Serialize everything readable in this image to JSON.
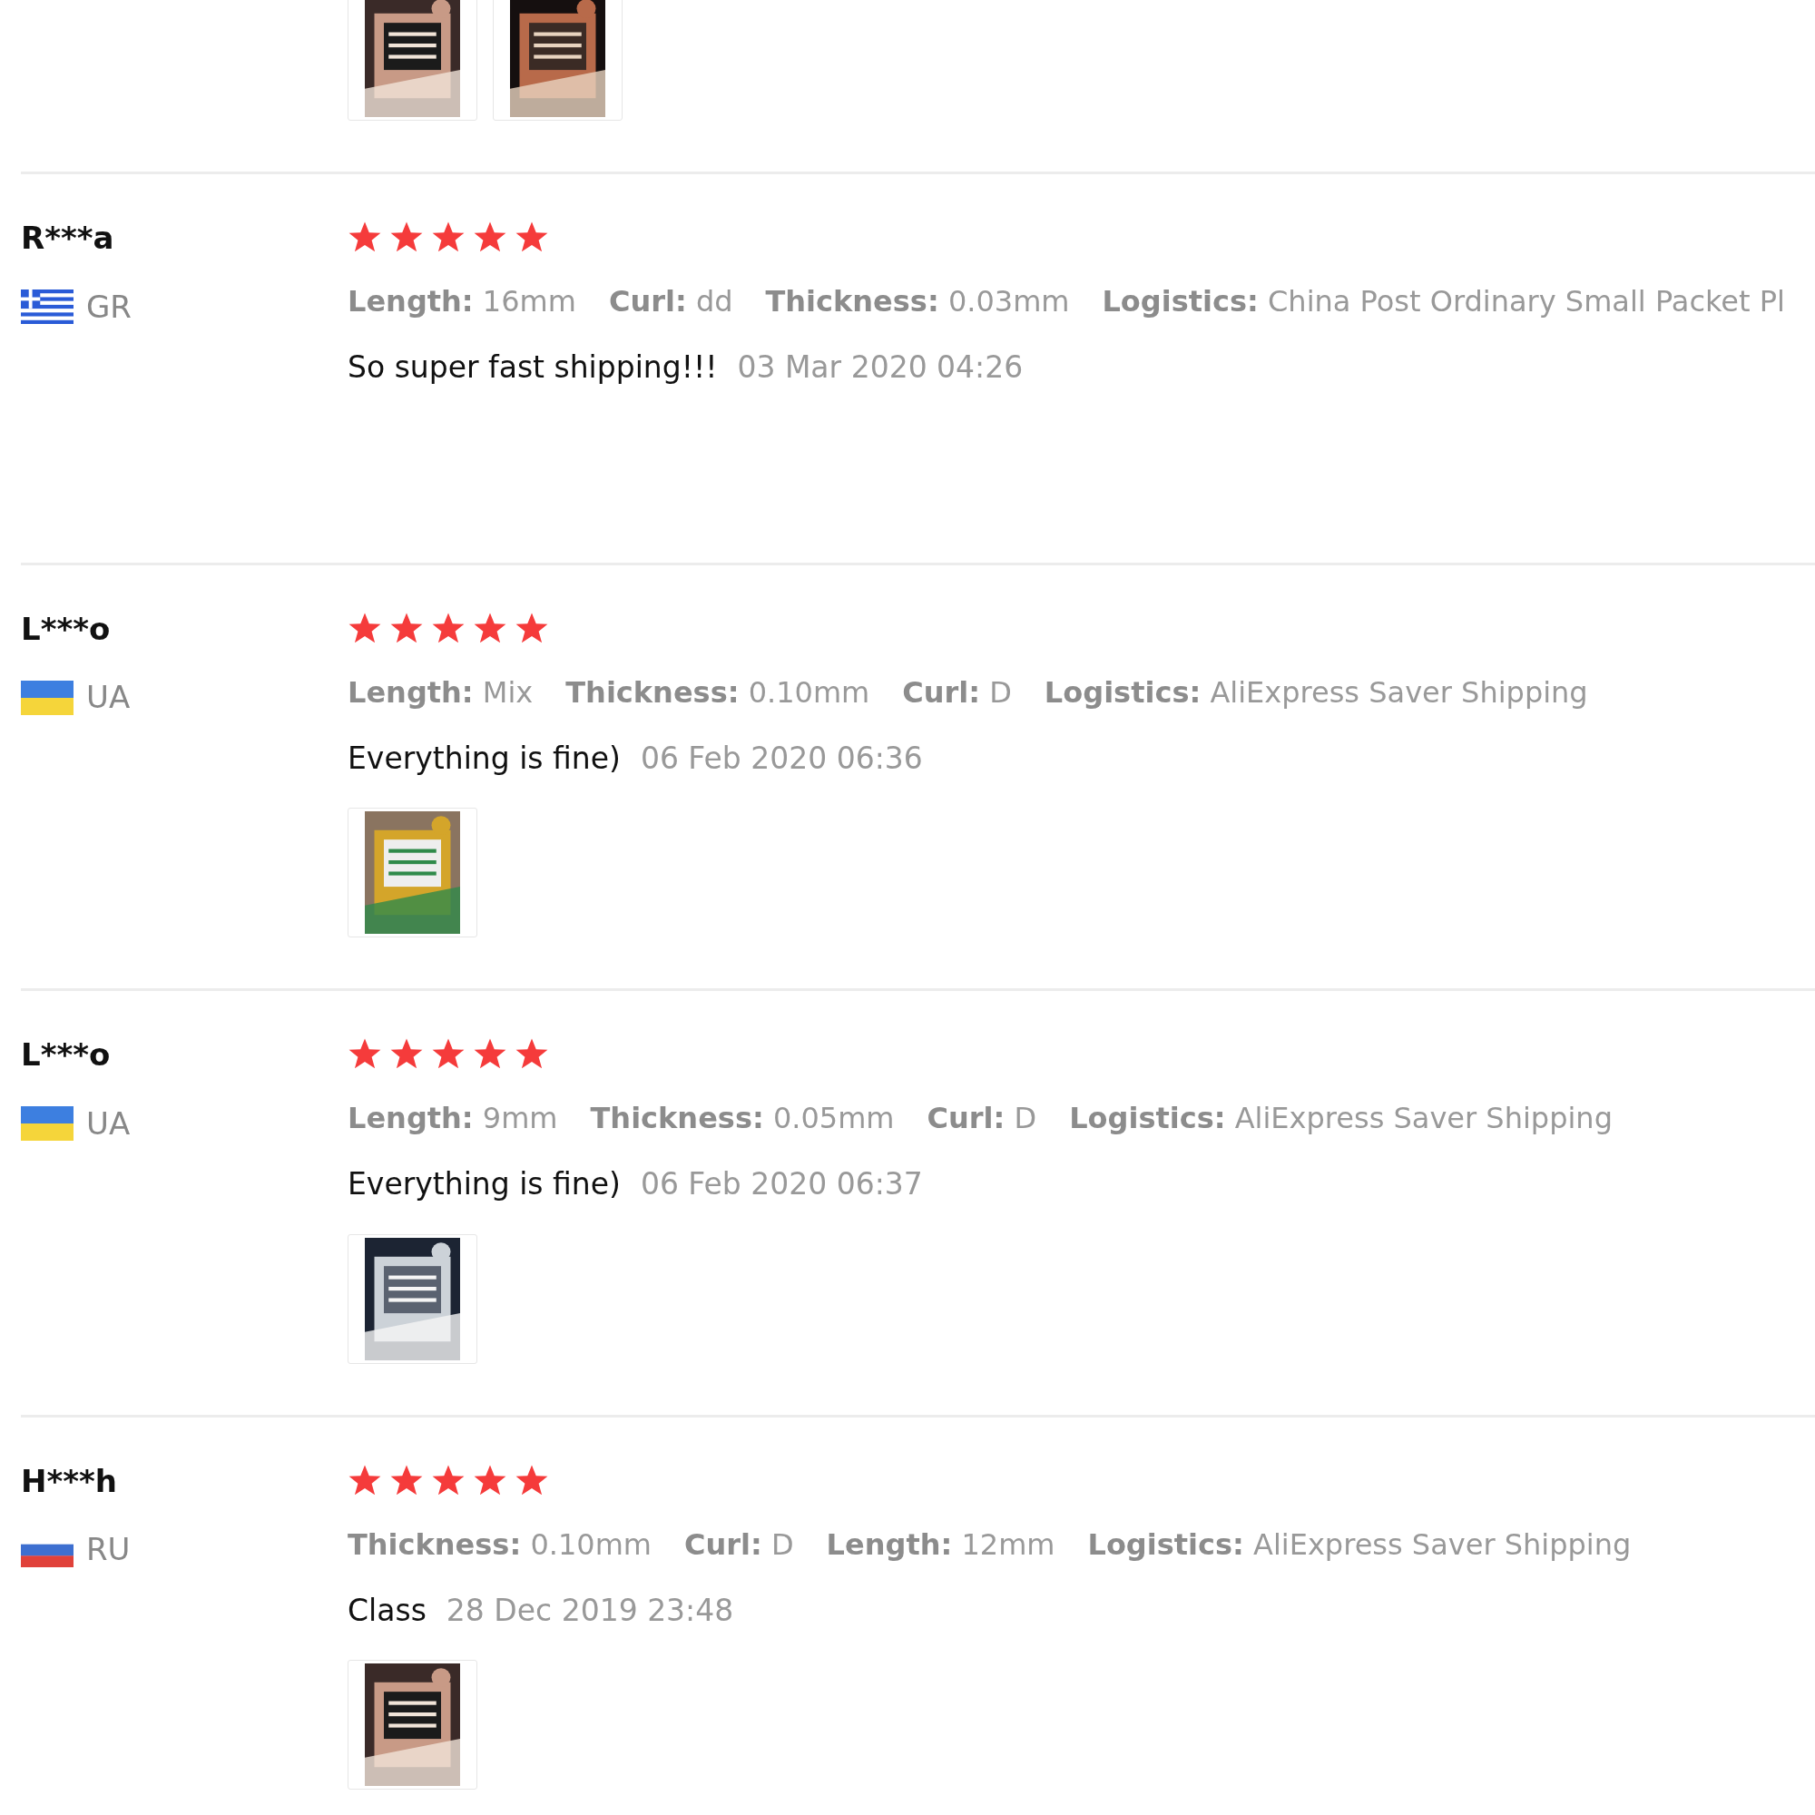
{
  "top_photos": [
    {
      "kind": "picture"
    },
    {
      "kind": "picture"
    }
  ],
  "reviews": [
    {
      "name": "R***a",
      "kind": "greece",
      "country": "GR",
      "stars": 5,
      "attributes": [
        {
          "label": "Length:",
          "value": "16mm"
        },
        {
          "label": "Curl:",
          "value": "dd"
        },
        {
          "label": "Thickness:",
          "value": "0.03mm"
        },
        {
          "label": "Logistics:",
          "value": "China Post Ordinary Small Packet Pl"
        }
      ],
      "comment": "So super fast shipping!!!",
      "date": "03 Mar 2020 04:26"
    },
    {
      "name": "L***o",
      "kind": "ukraine",
      "country": "UA",
      "stars": 5,
      "attributes": [
        {
          "label": "Length:",
          "value": "Mix"
        },
        {
          "label": "Thickness:",
          "value": "0.10mm"
        },
        {
          "label": "Curl:",
          "value": "D"
        },
        {
          "label": "Logistics:",
          "value": "AliExpress Saver Shipping"
        }
      ],
      "comment": "Everything is fine)",
      "date": "06 Feb 2020 06:36",
      "photos": [
        {
          "kind": "picture"
        }
      ]
    },
    {
      "name": "L***o",
      "kind": "ukraine",
      "country": "UA",
      "stars": 5,
      "attributes": [
        {
          "label": "Length:",
          "value": "9mm"
        },
        {
          "label": "Thickness:",
          "value": "0.05mm"
        },
        {
          "label": "Curl:",
          "value": "D"
        },
        {
          "label": "Logistics:",
          "value": "AliExpress Saver Shipping"
        }
      ],
      "comment": "Everything is fine)",
      "date": "06 Feb 2020 06:37",
      "photos": [
        {
          "kind": "picture"
        }
      ]
    },
    {
      "name": "H***h",
      "kind": "russia",
      "country": "RU",
      "stars": 5,
      "attributes": [
        {
          "label": "Thickness:",
          "value": "0.10mm"
        },
        {
          "label": "Curl:",
          "value": "D"
        },
        {
          "label": "Length:",
          "value": "12mm"
        },
        {
          "label": "Logistics:",
          "value": "AliExpress Saver Shipping"
        }
      ],
      "comment": "Class",
      "date": "28 Dec 2019 23:48",
      "photos": [
        {
          "kind": "picture"
        }
      ]
    }
  ]
}
